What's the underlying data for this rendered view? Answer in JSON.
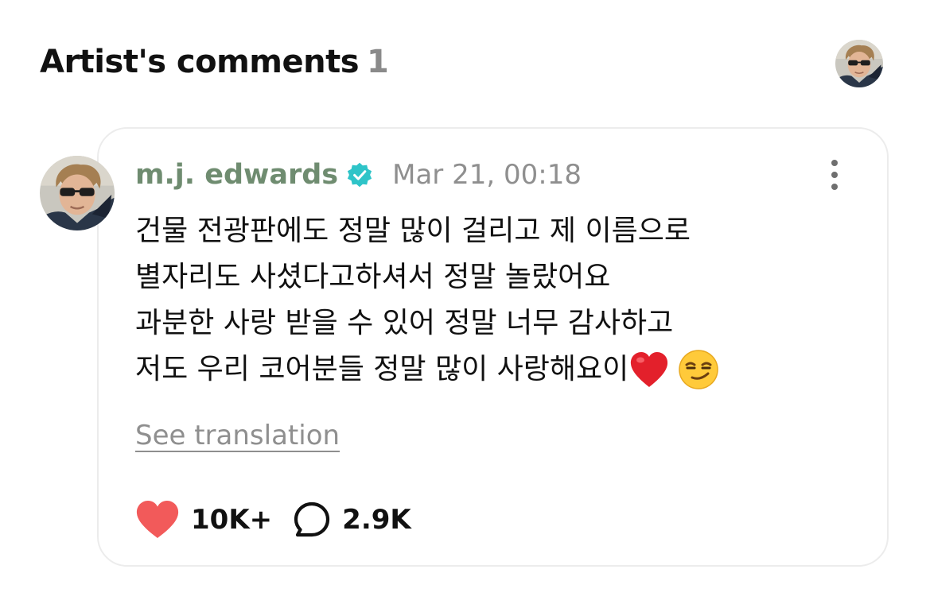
{
  "header": {
    "title": "Artist's comments",
    "count": "1",
    "avatar_icon": "artist-profile-avatar"
  },
  "comment": {
    "author": "m.j. edwards",
    "verified_icon": "verified-badge-icon",
    "timestamp": "Mar 21, 00:18",
    "more_icon": "more-vertical-icon",
    "lines": [
      "건물 전광판에도 정말 많이 걸리고 제 이름으로",
      "별자리도 사셨다고하셔서 정말 놀랐어요",
      "과분한 사랑 받을 수 있어 정말 너무 감사하고",
      "저도 우리 코어분들 정말 많이 사랑해요이"
    ],
    "emojis": [
      "red-heart-emoji",
      "smirking-face-emoji"
    ],
    "translation_link": "See translation",
    "likes": "10K+",
    "comments": "2.9K",
    "like_icon": "heart-icon",
    "comment_icon": "comment-bubble-icon"
  },
  "colors": {
    "author": "#6f8c70",
    "verified": "#2ec4c8",
    "muted": "#8f8f8f",
    "like": "#f25a5a",
    "card_border": "#ececec"
  }
}
